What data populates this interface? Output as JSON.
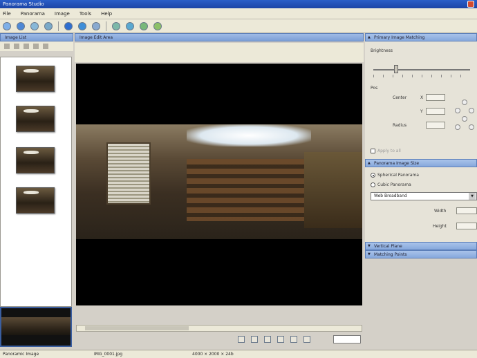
{
  "window": {
    "title": "Panorama Studio"
  },
  "menu": [
    "File",
    "Panorama",
    "Image",
    "Tools",
    "Help"
  ],
  "left_panel": {
    "header": "Image List"
  },
  "center_panel": {
    "header": "Image Edit Area"
  },
  "right_panel": {
    "sections": {
      "primary_image": {
        "header": "Primary Image Matching",
        "brightness_label": "Brightness",
        "position_label": "Pos",
        "center_label": "Center",
        "x_label": "X",
        "y_label": "Y",
        "radius_label": "Radius",
        "apply_label": "Apply to all"
      },
      "export": {
        "header": "Panorama Image Size",
        "option_spherical": "Spherical Panorama",
        "option_cubic": "Cubic Panorama",
        "preset": "Web Broadband",
        "width_label": "Width",
        "height_label": "Height"
      },
      "vertical": {
        "header": "Vertical Plane"
      },
      "matching": {
        "header": "Matching Points"
      }
    }
  },
  "status": {
    "left": "Panoramic Image",
    "file": "IMG_0001.jpg",
    "dims": "4000 × 2000 × 24b"
  },
  "colors": {
    "titlebar": "#1b44a6",
    "panel_header": "#86a8dc",
    "background": "#d4d0c8"
  }
}
